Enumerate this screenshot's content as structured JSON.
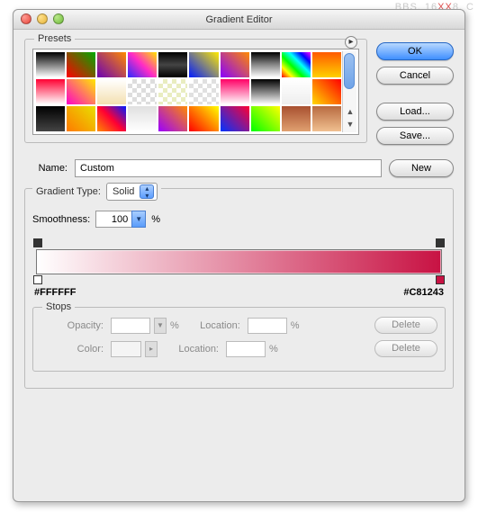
{
  "watermark": {
    "pre": "BBS. 16",
    "xx": "XX",
    "post": "8. C"
  },
  "title": "Gradient Editor",
  "presets": {
    "label": "Presets"
  },
  "buttons": {
    "ok": "OK",
    "cancel": "Cancel",
    "load": "Load...",
    "save": "Save...",
    "new": "New"
  },
  "name": {
    "label": "Name:",
    "value": "Custom"
  },
  "gradient_type": {
    "label": "Gradient Type:",
    "value": "Solid"
  },
  "smoothness": {
    "label": "Smoothness:",
    "value": "100",
    "unit": "%"
  },
  "gradient": {
    "left_hex": "#FFFFFF",
    "right_hex": "#C81243"
  },
  "stops": {
    "label": "Stops",
    "opacity_label": "Opacity:",
    "opacity_value": "",
    "opacity_unit": "%",
    "location_label": "Location:",
    "location_value": "",
    "location_unit": "%",
    "color_label": "Color:",
    "delete_label": "Delete"
  },
  "swatches": [
    "linear-gradient(#000,#fff)",
    "linear-gradient(45deg,#ff0000,#00aa00)",
    "linear-gradient(45deg,#6a00b5,#ff8a00)",
    "linear-gradient(45deg,#2b2bff,#ff2bc6,#ffe400)",
    "linear-gradient(#000,#444,#000)",
    "linear-gradient(45deg,#001aff,#ffea00)",
    "linear-gradient(45deg,#8800ff,#ff8a00)",
    "linear-gradient(#000,#888,#fff)",
    "linear-gradient(45deg,#ff0000,#ffff00,#00ff00,#00ffff,#0000ff,#ff00ff)",
    "linear-gradient(#ff5a00,#ffd000)",
    "linear-gradient(#ff0033,#ffffff)",
    "linear-gradient(45deg,#ff00c8,#ffea00)",
    "linear-gradient(#ffffff,#f4e0b0)",
    "conic-gradient(#ddd 25%,#fff 0 50%,#ddd 0 75%,#fff 0)",
    "conic-gradient(#e9edc0 25%,#fff 0 50%,#e9edc0 0 75%,#fff 0)",
    "conic-gradient(#e0e0e0 25%,#fff 0 50%,#e0e0e0 0 75%,#fff 0)",
    "linear-gradient(#ff0066,#fff)",
    "linear-gradient(#000,#fff)",
    "linear-gradient(#ffffff,#eeeeee)",
    "linear-gradient(45deg,#ffd900,#ff0000)",
    "linear-gradient(#000,#444)",
    "linear-gradient(45deg,#ff7a00,#e8e000)",
    "linear-gradient(45deg,#ff8a00,#ff0033,#001aff)",
    "linear-gradient(#e0e0e0,#ffffff)",
    "linear-gradient(45deg,#9a00ff,#ff8a00)",
    "linear-gradient(45deg,#ff0000,#ffff00)",
    "linear-gradient(45deg,#0033ff,#ff0033)",
    "linear-gradient(45deg,#00ff00,#ffff00)",
    "linear-gradient(#a85030,#e0a070)",
    "linear-gradient(#b86a40,#f0c090)"
  ]
}
